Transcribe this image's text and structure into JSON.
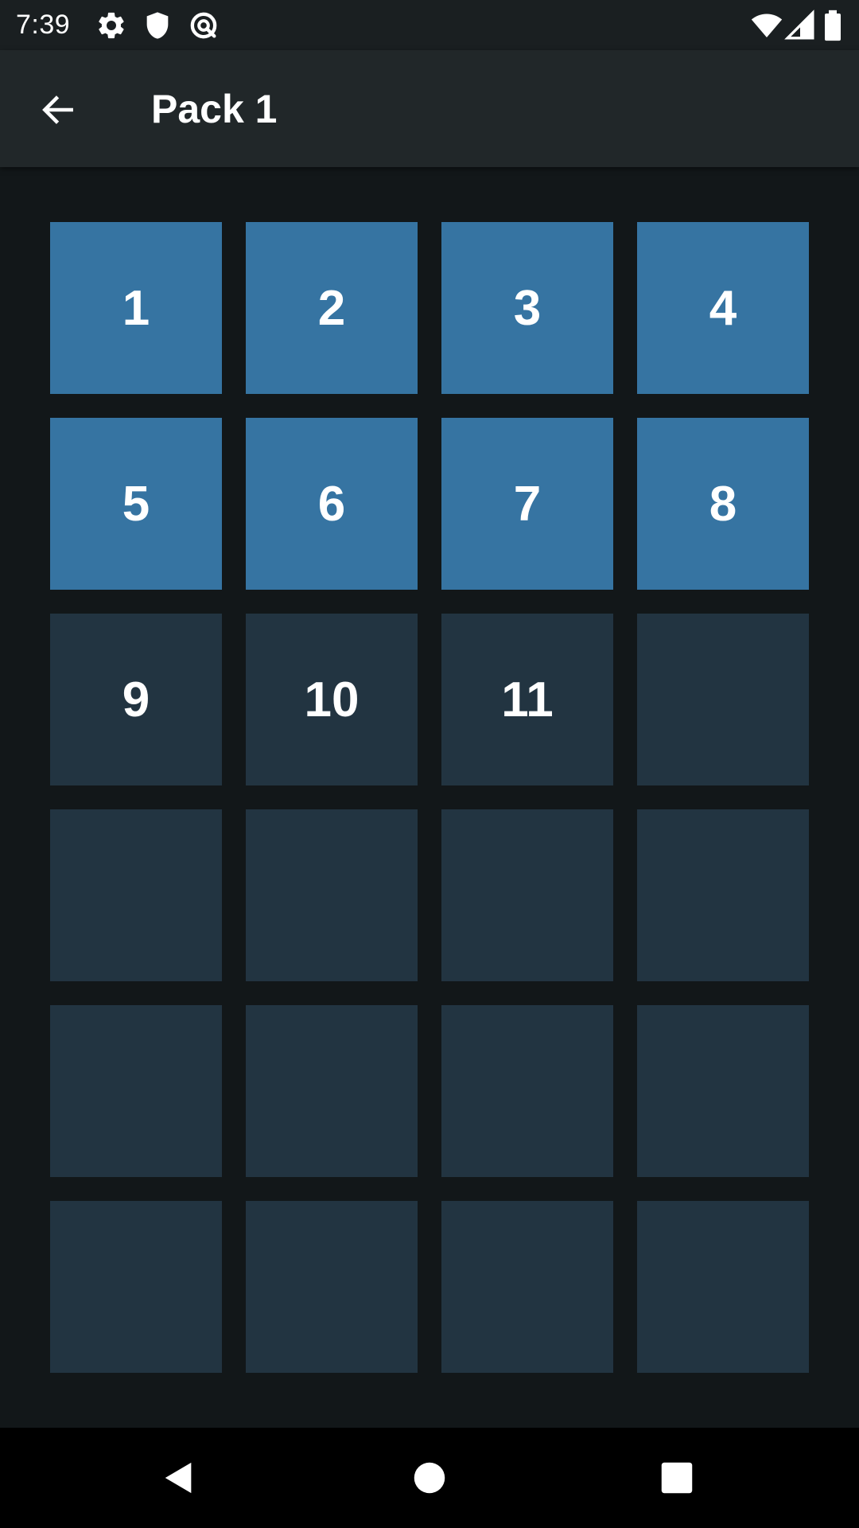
{
  "status_bar": {
    "time": "7:39",
    "left_icons": [
      "gear-icon",
      "shield-icon",
      "vpn-icon"
    ],
    "right_icons": [
      "wifi-icon",
      "signal-icon",
      "battery-icon"
    ]
  },
  "app_bar": {
    "title": "Pack 1",
    "back_icon": "arrow-left-icon"
  },
  "levels": {
    "columns": 4,
    "rows": 6,
    "unlocked_color": "#3674a2",
    "locked_color": "#223441",
    "tiles": [
      {
        "label": "1",
        "state": "unlocked"
      },
      {
        "label": "2",
        "state": "unlocked"
      },
      {
        "label": "3",
        "state": "unlocked"
      },
      {
        "label": "4",
        "state": "unlocked"
      },
      {
        "label": "5",
        "state": "unlocked"
      },
      {
        "label": "6",
        "state": "unlocked"
      },
      {
        "label": "7",
        "state": "unlocked"
      },
      {
        "label": "8",
        "state": "unlocked"
      },
      {
        "label": "9",
        "state": "locked"
      },
      {
        "label": "10",
        "state": "locked"
      },
      {
        "label": "11",
        "state": "locked"
      },
      {
        "label": "",
        "state": "locked"
      },
      {
        "label": "",
        "state": "locked"
      },
      {
        "label": "",
        "state": "locked"
      },
      {
        "label": "",
        "state": "locked"
      },
      {
        "label": "",
        "state": "locked"
      },
      {
        "label": "",
        "state": "locked"
      },
      {
        "label": "",
        "state": "locked"
      },
      {
        "label": "",
        "state": "locked"
      },
      {
        "label": "",
        "state": "locked"
      },
      {
        "label": "",
        "state": "locked"
      },
      {
        "label": "",
        "state": "locked"
      },
      {
        "label": "",
        "state": "locked"
      },
      {
        "label": "",
        "state": "locked"
      }
    ]
  },
  "nav_bar": {
    "buttons": [
      "back-triangle-icon",
      "home-circle-icon",
      "recents-square-icon"
    ]
  }
}
